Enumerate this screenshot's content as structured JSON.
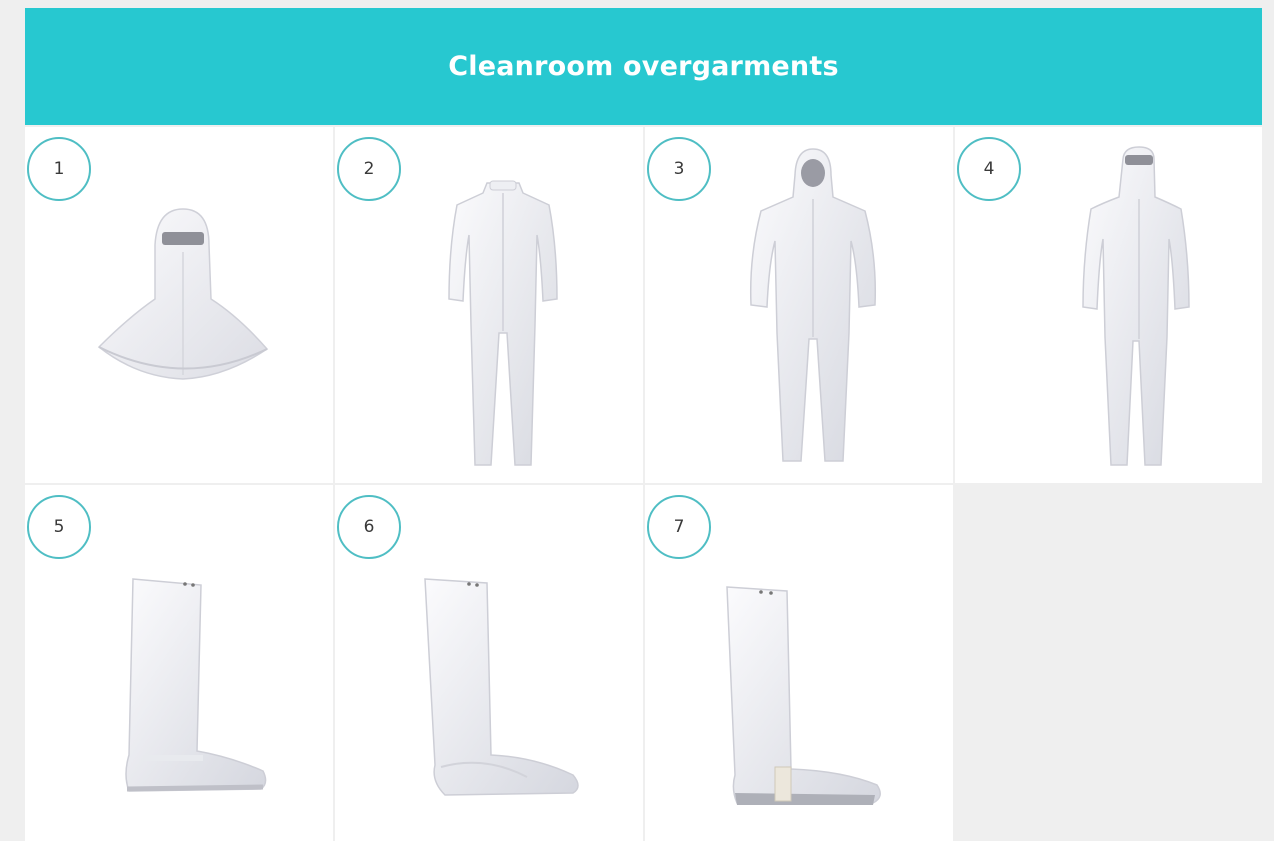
{
  "header": {
    "title": "Cleanroom overgarments"
  },
  "items": [
    {
      "number": "1",
      "icon": "hood-icon"
    },
    {
      "number": "2",
      "icon": "coverall-icon"
    },
    {
      "number": "3",
      "icon": "hooded-coverall-icon"
    },
    {
      "number": "4",
      "icon": "coverall-with-hood-icon"
    },
    {
      "number": "5",
      "icon": "tall-boot-cover-icon"
    },
    {
      "number": "6",
      "icon": "boot-cover-icon"
    },
    {
      "number": "7",
      "icon": "boot-cover-strap-icon"
    }
  ],
  "colors": {
    "accent": "#27c8d0",
    "circle_border": "#4fbec4",
    "background": "#efefef",
    "cell": "#ffffff"
  }
}
